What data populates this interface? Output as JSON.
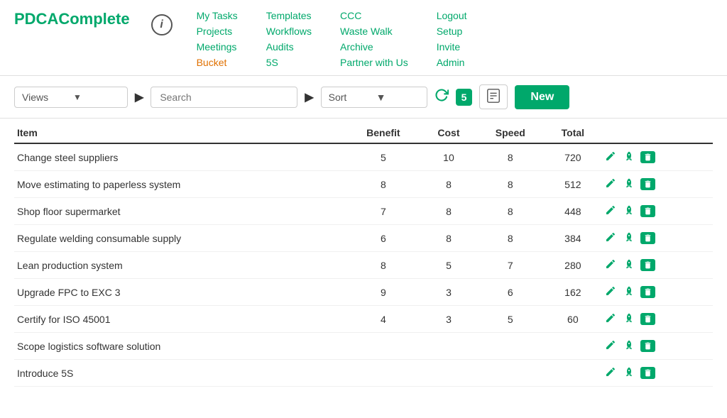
{
  "logo": {
    "part1": "PDCA",
    "part2": "Complete"
  },
  "nav": {
    "col1": [
      {
        "label": "My Tasks",
        "href": "#",
        "active": false
      },
      {
        "label": "Projects",
        "href": "#",
        "active": false
      },
      {
        "label": "Meetings",
        "href": "#",
        "active": false
      },
      {
        "label": "Bucket",
        "href": "#",
        "active": true
      }
    ],
    "col2": [
      {
        "label": "Templates",
        "href": "#",
        "active": false
      },
      {
        "label": "Workflows",
        "href": "#",
        "active": false
      },
      {
        "label": "Audits",
        "href": "#",
        "active": false
      },
      {
        "label": "5S",
        "href": "#",
        "active": false
      }
    ],
    "col3": [
      {
        "label": "CCC",
        "href": "#",
        "active": false
      },
      {
        "label": "Waste Walk",
        "href": "#",
        "active": false
      },
      {
        "label": "Archive",
        "href": "#",
        "active": false
      },
      {
        "label": "Partner with Us",
        "href": "#",
        "active": false
      }
    ],
    "col4": [
      {
        "label": "Logout",
        "href": "#",
        "active": false
      },
      {
        "label": "Setup",
        "href": "#",
        "active": false
      },
      {
        "label": "Invite",
        "href": "#",
        "active": false
      },
      {
        "label": "Admin",
        "href": "#",
        "active": false
      }
    ]
  },
  "toolbar": {
    "views_label": "Views",
    "search_placeholder": "Search",
    "sort_label": "Sort",
    "badge": "5",
    "pdf_label": "PDF",
    "new_label": "New"
  },
  "table": {
    "headers": [
      "Item",
      "Benefit",
      "Cost",
      "Speed",
      "Total"
    ],
    "rows": [
      {
        "item": "Change steel suppliers",
        "benefit": "5",
        "cost": "10",
        "speed": "8",
        "total": "720"
      },
      {
        "item": "Move estimating to paperless system",
        "benefit": "8",
        "cost": "8",
        "speed": "8",
        "total": "512"
      },
      {
        "item": "Shop floor supermarket",
        "benefit": "7",
        "cost": "8",
        "speed": "8",
        "total": "448"
      },
      {
        "item": "Regulate welding consumable supply",
        "benefit": "6",
        "cost": "8",
        "speed": "8",
        "total": "384"
      },
      {
        "item": "Lean production system",
        "benefit": "8",
        "cost": "5",
        "speed": "7",
        "total": "280"
      },
      {
        "item": "Upgrade FPC to EXC 3",
        "benefit": "9",
        "cost": "3",
        "speed": "6",
        "total": "162"
      },
      {
        "item": "Certify for ISO 45001",
        "benefit": "4",
        "cost": "3",
        "speed": "5",
        "total": "60"
      },
      {
        "item": "Scope logistics software solution",
        "benefit": "",
        "cost": "",
        "speed": "",
        "total": ""
      },
      {
        "item": "Introduce 5S",
        "benefit": "",
        "cost": "",
        "speed": "",
        "total": ""
      }
    ]
  },
  "colors": {
    "green": "#00a86b",
    "orange": "#e07000"
  }
}
